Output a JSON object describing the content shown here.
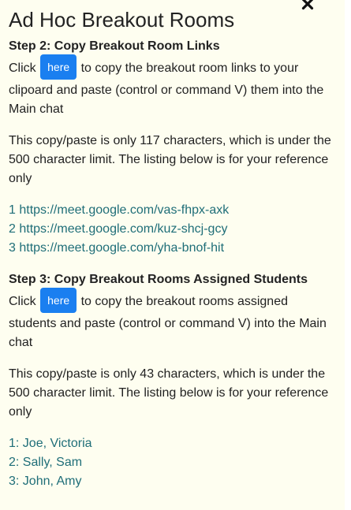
{
  "title": "Ad Hoc Breakout Rooms",
  "close_icon": "close-icon",
  "step2": {
    "heading": "Step 2: Copy Breakout Room Links",
    "click_label": "Click",
    "button_label": "here",
    "instruction_rest": "to copy the breakout room links to your clipoard and paste (control or command V) them into the Main chat",
    "note": "This copy/paste is only 117 characters, which is under the 500 character limit. The listing below is for your reference only",
    "links": [
      "1 https://meet.google.com/vas-fhpx-axk",
      "2 https://meet.google.com/kuz-shcj-gcy",
      "3 https://meet.google.com/yha-bnof-hit"
    ]
  },
  "step3": {
    "heading": "Step 3: Copy Breakout Rooms Assigned Students",
    "click_label": "Click",
    "button_label": "here",
    "instruction_rest": "to copy the breakout rooms assigned students and paste (control or command V) into the Main chat",
    "note": "This copy/paste is only 43 characters, which is under the 500 character limit. The listing below is for your reference only",
    "students": [
      "1: Joe, Victoria",
      "2: Sally, Sam",
      "3: John, Amy"
    ]
  },
  "colors": {
    "panel_bg": "#fefef0",
    "button_bg": "#1a7ff0",
    "list_text": "#1f6e78",
    "body_text": "#222222"
  }
}
